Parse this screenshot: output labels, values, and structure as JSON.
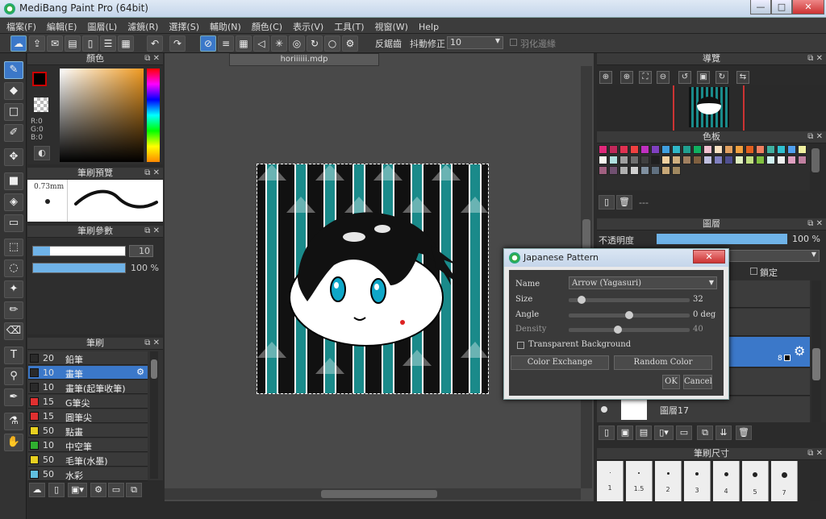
{
  "window": {
    "title": "MediBang Paint Pro (64bit)",
    "min": "—",
    "max": "□",
    "close": "✕"
  },
  "menu": [
    "檔案(F)",
    "編輯(E)",
    "圖層(L)",
    "濾鏡(R)",
    "選擇(S)",
    "輔助(N)",
    "顏色(C)",
    "表示(V)",
    "工具(T)",
    "視窗(W)",
    "Help"
  ],
  "toolbar": {
    "antialias_label": "反鋸齒",
    "stabilizer_label": "抖動修正",
    "stabilizer_value": "10",
    "feather_label": "羽化邊緣"
  },
  "doc_tab": "horiiiiii.mdp",
  "color_panel": {
    "title": "顏色",
    "r": "R:0",
    "g": "G:0",
    "b": "B:0"
  },
  "brush_preview": {
    "title": "筆刷預覽",
    "size": "0.73mm"
  },
  "brush_params": {
    "title": "筆刷參數",
    "size_value": "10",
    "opacity_value": "100 %"
  },
  "brush_list": {
    "title": "筆刷",
    "items": [
      {
        "size": "20",
        "name": "鉛筆",
        "color": "#2a2a2a"
      },
      {
        "size": "10",
        "name": "畫筆",
        "color": "#2a2a2a",
        "selected": true
      },
      {
        "size": "10",
        "name": "畫筆(起筆收筆)",
        "color": "#2a2a2a"
      },
      {
        "size": "15",
        "name": "G筆尖",
        "color": "#e03030"
      },
      {
        "size": "15",
        "name": "圓筆尖",
        "color": "#e03030"
      },
      {
        "size": "50",
        "name": "點畫",
        "color": "#e8d020"
      },
      {
        "size": "10",
        "name": "中空筆",
        "color": "#30b030"
      },
      {
        "size": "50",
        "name": "毛筆(水墨)",
        "color": "#e8d020"
      },
      {
        "size": "50",
        "name": "水彩",
        "color": "#60c0e0"
      }
    ]
  },
  "navigator": {
    "title": "導覽"
  },
  "palette": {
    "title": "色板",
    "more": "---",
    "colors": [
      "#e0287a",
      "#c0285a",
      "#e03050",
      "#f04040",
      "#c030c0",
      "#8040c0",
      "#40a0e0",
      "#30b8c8",
      "#20a090",
      "#10b060",
      "#f0c0d0",
      "#f8e0c0",
      "#e0a060",
      "#f0a040",
      "#e06020",
      "#f08060",
      "#40b0a0",
      "#30c0d0",
      "#50a0f0",
      "#f0f0a0",
      "#f8f8f0",
      "#b0e0e0",
      "#a0a0a0",
      "#707070",
      "#404040",
      "#202020",
      "#f0d0a0",
      "#d0b080",
      "#a08060",
      "#806040",
      "#c0c0e0",
      "#8080c0",
      "#505090",
      "#e0f0c0",
      "#c0e080",
      "#80c040",
      "#d0f0f0",
      "#f0f0f0",
      "#e0a0c0",
      "#c080a0",
      "#a06080",
      "#705070",
      "#b0b0b0",
      "#d0d0d0",
      "#8090a0",
      "#607080",
      "#c8a878",
      "#a08860"
    ]
  },
  "layers": {
    "title": "圖層",
    "opacity_label": "不透明度",
    "opacity_value": "100 %",
    "lock_label": "鎖定",
    "layer17": "圖層17",
    "layer8": "8"
  },
  "brush_size": {
    "title": "筆刷尺寸",
    "sizes": [
      "1",
      "1.5",
      "2",
      "3",
      "4",
      "5",
      "7"
    ]
  },
  "dialog": {
    "title": "Japanese Pattern",
    "name_label": "Name",
    "name_value": "Arrow (Yagasuri)",
    "size_label": "Size",
    "size_value": "32",
    "size_frac": 0.08,
    "angle_label": "Angle",
    "angle_value": "0 deg",
    "angle_frac": 0.5,
    "density_label": "Density",
    "density_value": "40",
    "density_frac": 0.4,
    "transparent_label": "Transparent Background",
    "color_exchange": "Color Exchange",
    "random_color": "Random Color",
    "ok": "OK",
    "cancel": "Cancel"
  }
}
